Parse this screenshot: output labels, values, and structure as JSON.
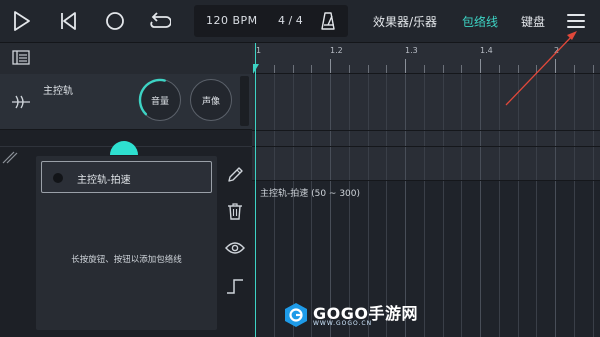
{
  "toolbar": {
    "play_icon": "play-icon",
    "rewind_icon": "skip-to-start-icon",
    "record_icon": "record-icon",
    "loop_icon": "loop-icon",
    "tempo": "120 BPM",
    "time_signature": "4 / 4",
    "metronome_icon": "metronome-icon",
    "menu": [
      {
        "label": "效果器/乐器"
      },
      {
        "label": "包络线",
        "active": true
      },
      {
        "label": "键盘"
      }
    ],
    "more_icon": "hamburger-menu-icon"
  },
  "ruler": {
    "marks": [
      "1",
      "1.2",
      "1.3",
      "1.4",
      "2"
    ]
  },
  "track": {
    "name": "主控轨",
    "volume_label": "音量",
    "pan_label": "声像",
    "volume_level": 0.55
  },
  "automation": {
    "selected_param": "主控轨-拍速",
    "hint": "长按旋钮、按钮以添加包络线",
    "lane_label": "主控轨-拍速 (50 ~ 300)"
  },
  "tools": [
    "pencil-icon",
    "trash-icon",
    "eye-icon",
    "step-icon"
  ],
  "watermark": {
    "title": "GOGO手游网",
    "subtitle": "WWW.GOGO.CN"
  },
  "colors": {
    "accent": "#3dd3c4",
    "annotation_arrow": "#e0483a",
    "watermark_blue": "#1e9be8"
  }
}
